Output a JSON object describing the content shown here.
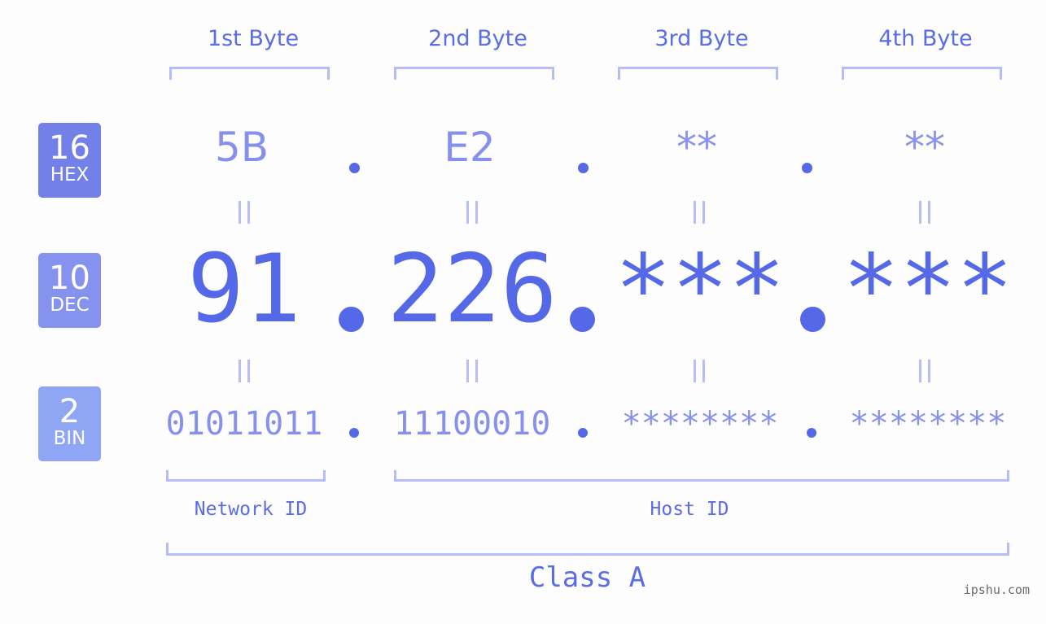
{
  "byte_headers": [
    "1st Byte",
    "2nd Byte",
    "3rd Byte",
    "4th Byte"
  ],
  "badges": [
    {
      "base": "16",
      "label": "HEX",
      "color": "#7380e8"
    },
    {
      "base": "10",
      "label": "DEC",
      "color": "#8593ef"
    },
    {
      "base": "2",
      "label": "BIN",
      "color": "#8fa6f5"
    }
  ],
  "hex": [
    "5B",
    "E2",
    "**",
    "**"
  ],
  "dec": [
    "91",
    "226",
    "***",
    "***"
  ],
  "bin": [
    "01011011",
    "11100010",
    "********",
    "********"
  ],
  "separator": ".",
  "parts": {
    "network": "Network ID",
    "host": "Host ID"
  },
  "class_label": "Class A",
  "watermark": "ipshu.com",
  "colors": {
    "primary": "#5468e8",
    "secondary": "#8890ee",
    "bracket": "#b4bdf8"
  }
}
